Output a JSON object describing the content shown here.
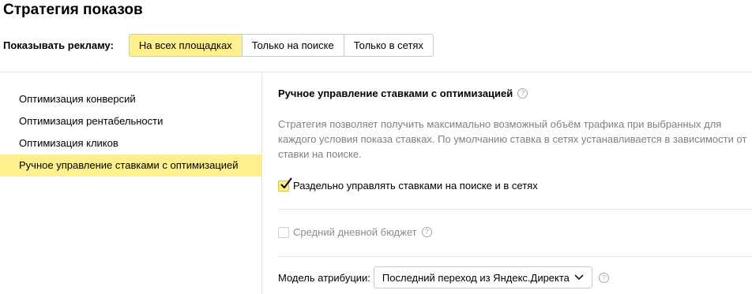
{
  "page": {
    "title": "Стратегия показов"
  },
  "show_ads": {
    "label": "Показывать рекламу:",
    "options": [
      "На всех площадках",
      "Только на поиске",
      "Только в сетях"
    ],
    "selected": "На всех площадках"
  },
  "strategies": {
    "items": [
      "Оптимизация конверсий",
      "Оптимизация рентабельности",
      "Оптимизация кликов",
      "Ручное управление ставками с оптимизацией"
    ],
    "selected": "Ручное управление ставками с оптимизацией"
  },
  "detail": {
    "title": "Ручное управление ставками с оптимизацией",
    "help_glyph": "?",
    "description": "Стратегия позволяет получить максимально возможный объём трафика при выбранных для каждого условия показа ставках. По умолчанию ставка в сетях устанавливается в зависимости от ставки на поиске.",
    "separate_bids": {
      "label": "Раздельно управлять ставками на поиске и в сетях",
      "checked": true
    },
    "daily_budget": {
      "label": "Средний дневной бюджет",
      "checked": false,
      "disabled": true
    },
    "attribution": {
      "label": "Модель атрибуции:",
      "value": "Последний переход из Яндекс.Директа"
    }
  },
  "colors": {
    "accent": "#fef08f",
    "border": "#c9c9c9",
    "muted_text": "#808080"
  },
  "icons": {
    "checkmark": "checkmark-icon",
    "help": "help-icon",
    "chevron": "chevron-down-icon"
  }
}
